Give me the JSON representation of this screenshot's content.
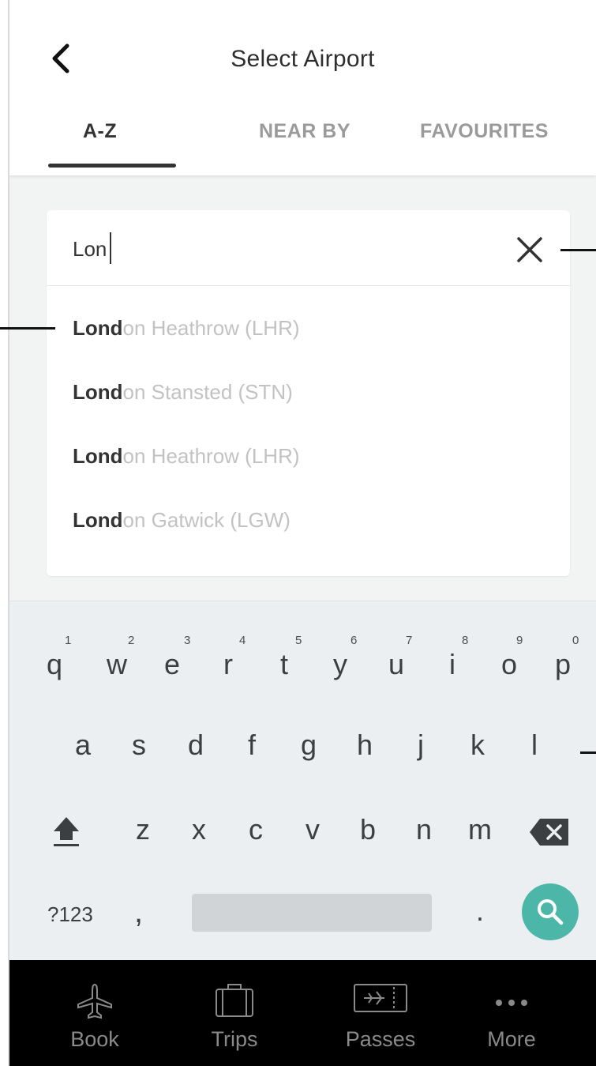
{
  "header": {
    "title": "Select Airport",
    "tabs": [
      {
        "label": "A-Z",
        "active": true
      },
      {
        "label": "NEAR BY",
        "active": false
      },
      {
        "label": "FAVOURITES",
        "active": false
      }
    ]
  },
  "search": {
    "value": "Lon",
    "results": [
      {
        "match": "Lond",
        "rest": "on Heathrow (LHR)"
      },
      {
        "match": "Lond",
        "rest": "on Stansted (STN)"
      },
      {
        "match": "Lond",
        "rest": "on Heathrow (LHR)"
      },
      {
        "match": "Lond",
        "rest": "on Gatwick (LGW)"
      }
    ]
  },
  "keyboard": {
    "row1": [
      "q",
      "w",
      "e",
      "r",
      "t",
      "y",
      "u",
      "i",
      "o",
      "p"
    ],
    "row1_hints": [
      "1",
      "2",
      "3",
      "4",
      "5",
      "6",
      "7",
      "8",
      "9",
      "0"
    ],
    "row2": [
      "a",
      "s",
      "d",
      "f",
      "g",
      "h",
      "j",
      "k",
      "l"
    ],
    "row3": [
      "z",
      "x",
      "c",
      "v",
      "b",
      "n",
      "m"
    ],
    "symbols_label": "?123",
    "comma": ",",
    "period": "."
  },
  "bottom_nav": [
    {
      "label": "Book",
      "icon": "airplane-icon"
    },
    {
      "label": "Trips",
      "icon": "suitcase-icon"
    },
    {
      "label": "Passes",
      "icon": "boarding-pass-icon"
    },
    {
      "label": "More",
      "icon": "more-dots-icon"
    }
  ],
  "colors": {
    "accent": "#4cb7a9",
    "text_primary": "#333333",
    "text_muted": "#c2c2c2",
    "nav_background": "#000000",
    "keyboard_background": "#eceff1"
  }
}
